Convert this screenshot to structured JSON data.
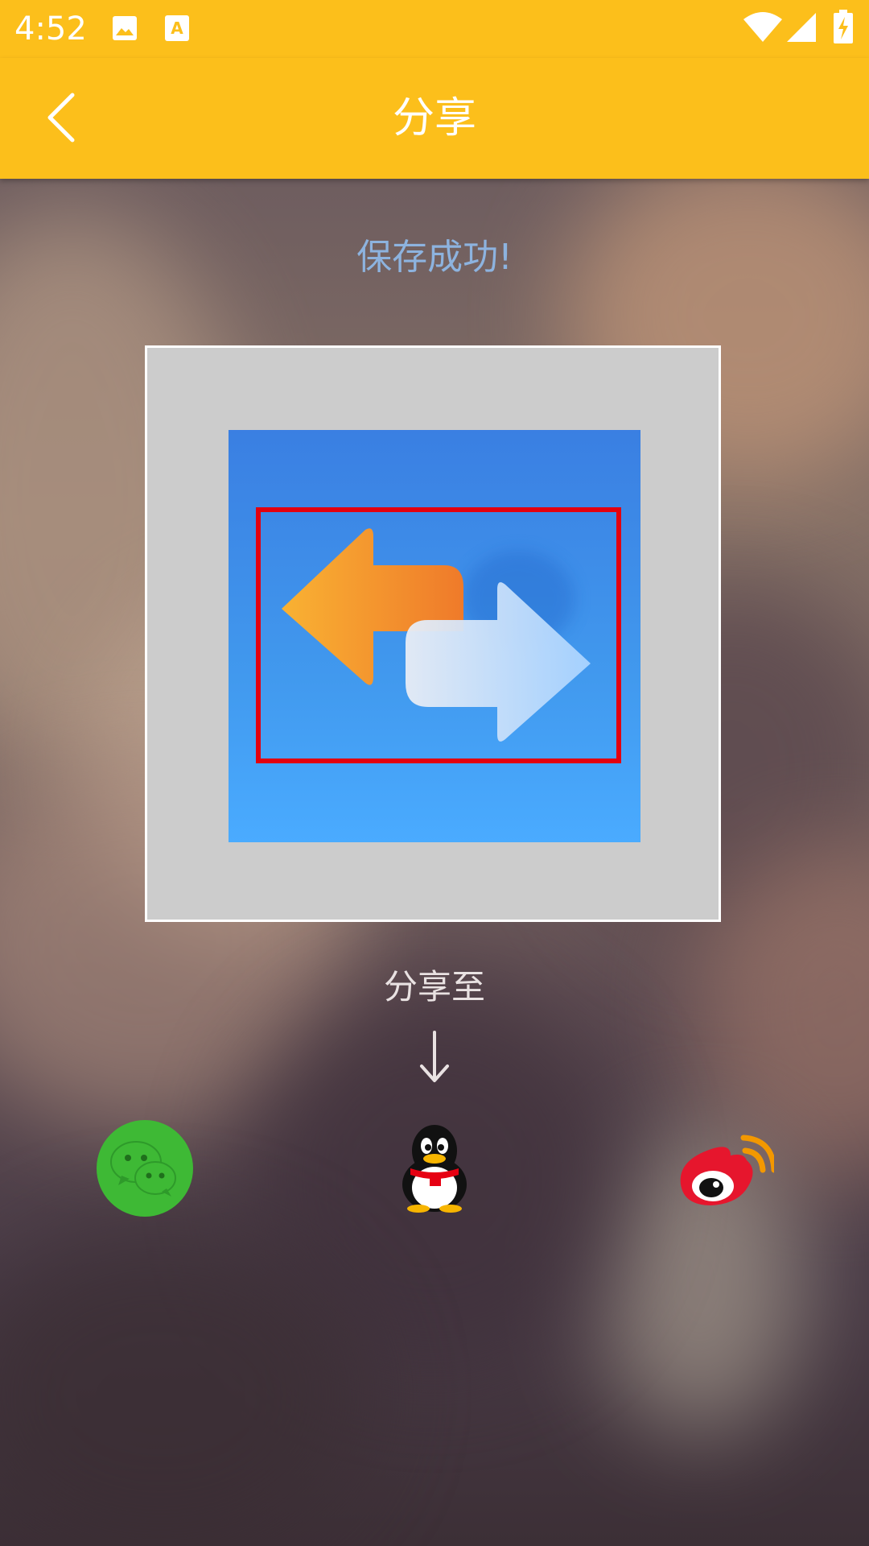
{
  "status_bar": {
    "time": "4:52",
    "icons": [
      "image-icon",
      "a-text-icon",
      "wifi-icon",
      "cell-signal-icon",
      "battery-charging-icon"
    ]
  },
  "toolbar": {
    "back_icon": "chevron-left-icon",
    "title": "分享"
  },
  "main": {
    "save_message": "保存成功!",
    "preview": {
      "image": "app-logo-swap-arrows",
      "highlight_color": "#e3000f"
    },
    "share_to_label": "分享至",
    "share_targets": [
      {
        "name": "wechat",
        "icon": "wechat-icon",
        "color": "#3eb935"
      },
      {
        "name": "qq",
        "icon": "qq-penguin-icon",
        "color": "#000000"
      },
      {
        "name": "weibo",
        "icon": "weibo-icon",
        "color": "#e6162d"
      }
    ]
  },
  "colors": {
    "accent": "#fcbf1b",
    "save_message": "#8db3df",
    "label": "#e9e2e2"
  }
}
